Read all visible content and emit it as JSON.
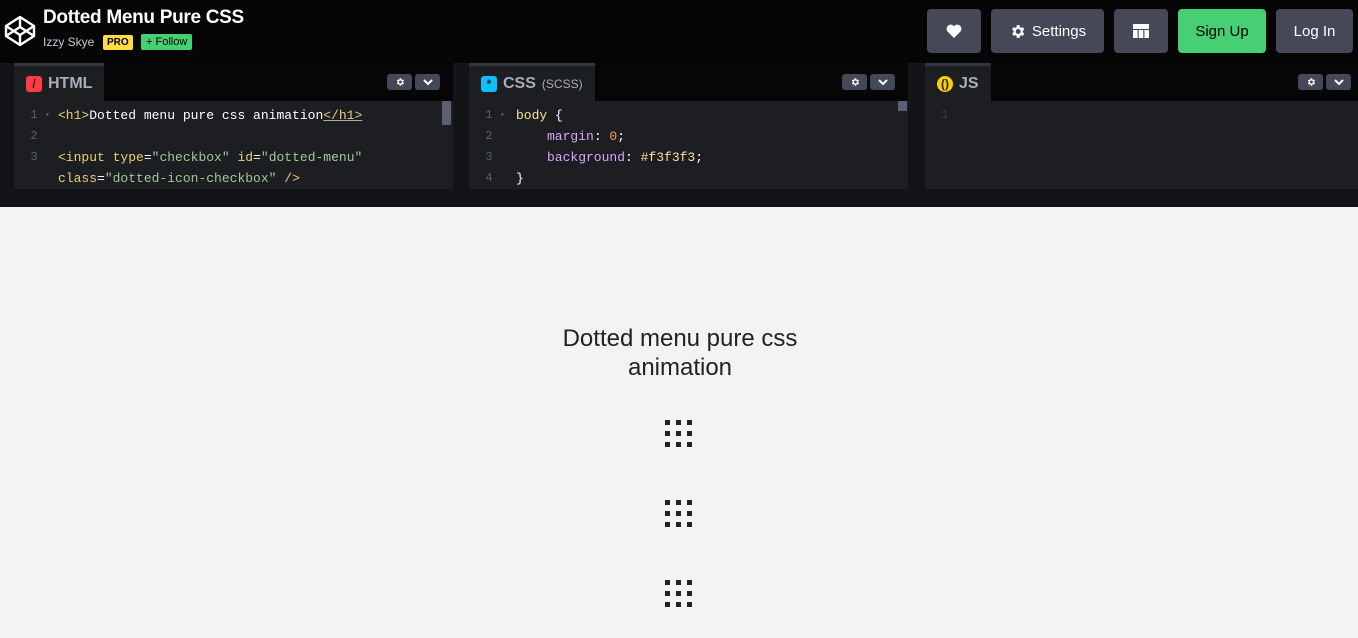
{
  "header": {
    "title": "Dotted Menu Pure CSS",
    "author": "Izzy Skye",
    "badge": "PRO",
    "follow_label": "Follow",
    "settings_label": "Settings",
    "signup_label": "Sign Up",
    "login_label": "Log In"
  },
  "panels": {
    "html": {
      "label": "HTML",
      "line_numbers": [
        "1",
        "2",
        "3"
      ]
    },
    "css": {
      "label": "CSS",
      "sub": "(SCSS)",
      "line_numbers": [
        "1",
        "2",
        "3",
        "4"
      ]
    },
    "js": {
      "label": "JS",
      "line_numbers": [
        "1"
      ]
    }
  },
  "html_code": {
    "l1_open": "<h1>",
    "l1_text": "Dotted menu pure css animation",
    "l1_close": "</h1>",
    "l3_tag": "<input ",
    "l3_type_attr": "type",
    "l3_type_val": "\"checkbox\"",
    "l3_id_attr": "id",
    "l3_id_val": "\"dotted-menu\"",
    "l3b_class_attr": "class",
    "l3b_class_val": "\"dotted-icon-checkbox\"",
    "l3b_end": " />"
  },
  "css_code": {
    "l1_sel": "body",
    "l1_brace": " {",
    "l2_prop": "margin",
    "l2_val": "0",
    "l3_prop": "background",
    "l3_val": "#f3f3f3",
    "l4": "}"
  },
  "preview": {
    "heading": "Dotted menu pure css animation"
  },
  "colors": {
    "accent_green": "#47cf73",
    "pro_yellow": "#ffdd40",
    "header_bg": "#050505",
    "button_bg": "#444857",
    "preview_bg": "#f3f3f3"
  },
  "icons": [
    "codepen-logo-icon",
    "heart-icon",
    "gear-icon",
    "layout-icon",
    "settings-gear-icon",
    "chevron-down-icon"
  ]
}
